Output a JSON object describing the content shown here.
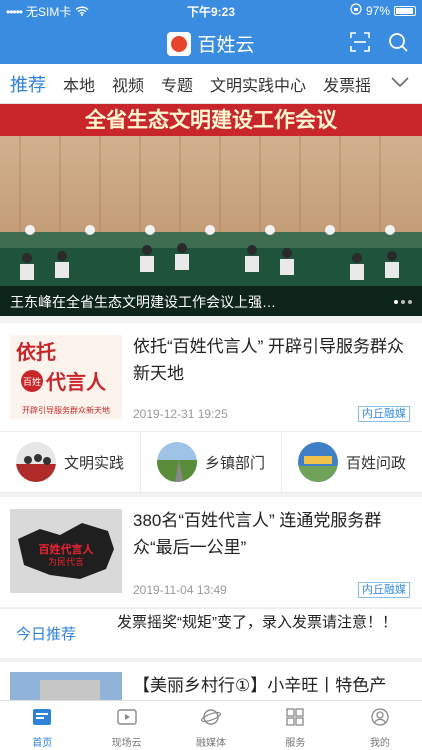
{
  "status": {
    "carrier": "无SIM卡",
    "time": "下午9:23",
    "battery": "97%"
  },
  "header": {
    "app_name": "百姓云"
  },
  "tabs": [
    "推荐",
    "本地",
    "视频",
    "专题",
    "文明实践中心",
    "发票摇"
  ],
  "banner": {
    "headline_text": "全省生态文明建设工作会议",
    "caption": "王东峰在全省生态文明建设工作会议上强…"
  },
  "articles": [
    {
      "title": "依托“百姓代言人” 开辟引导服务群众新天地",
      "date": "2019-12-31 19:25",
      "source": "内丘融媒",
      "thumb_text_1": "依托",
      "thumb_text_2": "代言人",
      "thumb_badge": "百姓",
      "thumb_caption": "开辟引导服务群众新天地"
    },
    {
      "title": "380名“百姓代言人” 连通党服务群众“最后一公里”",
      "date": "2019-11-04 13:49",
      "source": "内丘融媒",
      "thumb_text": "百姓代言人",
      "thumb_text_2": "为民代言"
    }
  ],
  "shortcuts": [
    {
      "label": "文明实践"
    },
    {
      "label": "乡镇部门"
    },
    {
      "label": "百姓问政"
    }
  ],
  "today": {
    "label": "今日推荐",
    "text": "发票摇奖“规矩”变了，录入发票请注意！！"
  },
  "partial_article": {
    "title": "【美丽乡村行①】小辛旺丨特色产"
  },
  "tabbar": [
    {
      "label": "首页",
      "icon": "news-icon",
      "active": true
    },
    {
      "label": "现场云",
      "icon": "video-icon"
    },
    {
      "label": "融媒体",
      "icon": "planet-icon"
    },
    {
      "label": "服务",
      "icon": "grid-icon"
    },
    {
      "label": "我的",
      "icon": "user-icon"
    }
  ],
  "colors": {
    "primary": "#3a8ce0",
    "active_tab": "#2e82d8",
    "banner_red": "#c8262b"
  }
}
